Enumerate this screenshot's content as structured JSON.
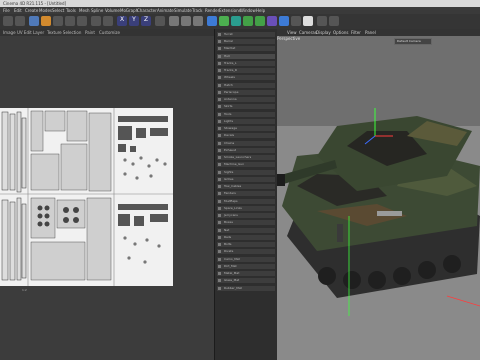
{
  "window": {
    "title": "Cinema 4D R21.115 - [Untitled]"
  },
  "menubar": {
    "items": [
      "File",
      "Edit",
      "Create",
      "Modes",
      "Select",
      "Tools",
      "Mesh",
      "Spline",
      "Volume",
      "MoGraph",
      "Character",
      "Animate",
      "Simulate",
      "Track",
      "Render",
      "Extensions",
      "Window",
      "Help"
    ]
  },
  "uv_menu": {
    "items": [
      "Image",
      "UV Edit",
      "Layer",
      "Texture Selection",
      "Paint",
      "Customize"
    ]
  },
  "uv_status": {
    "value": "1:2"
  },
  "viewport": {
    "menu": [
      "View",
      "Cameras",
      "Display",
      "Options",
      "Filter",
      "Panel"
    ],
    "label": "Perspective",
    "camera": "Default Camera"
  },
  "objects": [
    "Turret",
    "Barrel",
    "Mantlet",
    "Hull",
    "Tracks_L",
    "Tracks_R",
    "Wheels",
    "Hatch",
    "Periscope",
    "Antenna",
    "Skirts",
    "Tools",
    "Lights",
    "Stowage",
    "Decals",
    "Chains",
    "Exhaust",
    "Smoke_Launchers",
    "Machine_Gun",
    "Sights",
    "Grilles",
    "Tow_Cables",
    "Fenders",
    "Mudflaps",
    "Spare_Links",
    "Jerrycans",
    "Boxes",
    "Net",
    "Rails",
    "Bolts",
    "Rivets",
    "Camo_Mat",
    "Dirt_Mat",
    "Metal_Mat",
    "Glass_Mat",
    "Rubber_Mat"
  ],
  "colors": {
    "accent": "#3d7bd6",
    "uv_bg": "#3c3c3c",
    "viewport_bg": "#7f7f7f"
  }
}
